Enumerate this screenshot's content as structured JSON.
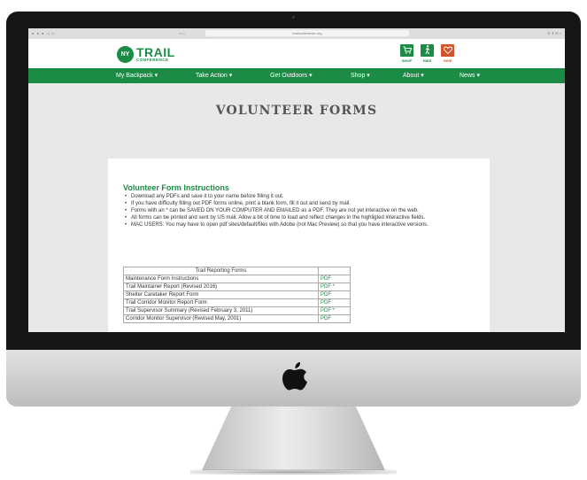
{
  "browser": {
    "url": "trailconference.org",
    "controls": "● ● ●  ◁ ▷",
    "toolbar_right": "⚙ ⬆ ⊞ +"
  },
  "site": {
    "logo_mark": "NY NJ",
    "logo_name": "TRAIL",
    "logo_subtitle": "CONFERENCE",
    "quick_links": [
      {
        "label": "SHOP",
        "icon": "cart-icon",
        "color": "#1c8b46"
      },
      {
        "label": "HIKE",
        "icon": "hiker-icon",
        "color": "#1c8b46"
      },
      {
        "label": "GIVE",
        "icon": "heart-icon",
        "color": "#d1542b"
      }
    ]
  },
  "nav": {
    "items": [
      {
        "label": "My Backpack ▾"
      },
      {
        "label": "Take Action ▾"
      },
      {
        "label": "Get Outdoors ▾"
      },
      {
        "label": "Shop ▾"
      },
      {
        "label": "About ▾"
      },
      {
        "label": "News ▾"
      }
    ]
  },
  "page": {
    "title": "VOLUNTEER FORMS",
    "section_title": "Volunteer Form Instructions",
    "instructions": [
      "Download any PDFs and save it to your name before filling it out.",
      "If you have difficulty filling out PDF forms online, print a blank form, fill it out and send by mail.",
      "Forms with an * can be SAVED ON YOUR COMPUTER AND EMAILED as a PDF. They are not yet interactive on the web.",
      "All forms can be printed and sent by US mail. Allow a bit of time to load and reflect changes in the highligted interactive fields.",
      "MAC USERS: You may have to open pdf sites/default/files with Adobe (not Mac Preview) so that you have interactive versions."
    ],
    "table": {
      "header": "Trail Reporting Forms",
      "rows": [
        {
          "name": "Maintenance Form Instructions",
          "link": "PDF"
        },
        {
          "name": "Trail Maintainer Report (Revised 2016)",
          "link": "PDF *"
        },
        {
          "name": "Shelter Caretaker Report Form",
          "link": "PDF"
        },
        {
          "name": "Trail Corridor Monitor Report Form",
          "link": "PDF"
        },
        {
          "name": "Trail Supervisor Summary  (Revised February 3, 2011)",
          "link": "PDF *"
        },
        {
          "name": "Corridor Monitor Supervisor (Revised May, 2001)",
          "link": "PDF"
        }
      ]
    }
  },
  "colors": {
    "brand_green": "#1c8b46",
    "give_orange": "#d1542b",
    "page_background": "#e8e8e8"
  },
  "device": {
    "type": "iMac",
    "chin_logo": "apple-logo"
  }
}
